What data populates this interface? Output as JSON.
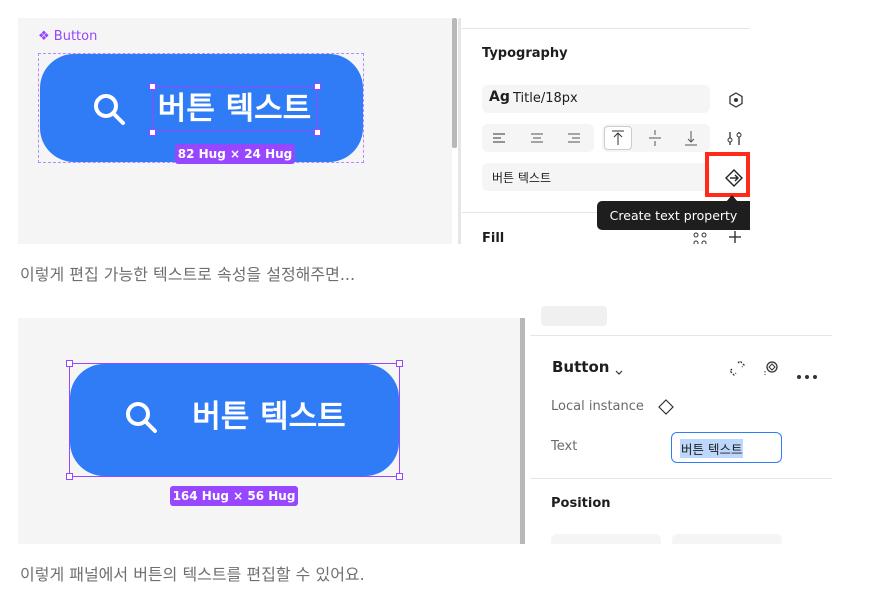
{
  "top": {
    "component_label": "❖ Button",
    "button_text": "버튼 텍스트",
    "size_badge": "82 Hug × 24 Hug",
    "panel": {
      "typography_title": "Typography",
      "text_style_prefix": "Ag",
      "text_style_name": "Title/18px",
      "text_value": "버튼 텍스트",
      "tooltip": "Create text property",
      "fill_title": "Fill"
    },
    "caption": "이렇게 편집 가능한 텍스트로 속성을 설정해주면..."
  },
  "bottom": {
    "button_text": "버튼 텍스트",
    "size_badge": "164 Hug × 56 Hug",
    "panel": {
      "component_name": "Button",
      "local_instance": "Local instance",
      "text_label": "Text",
      "text_value": "버튼 텍스트",
      "position_title": "Position"
    },
    "caption": "이렇게 패널에서 버튼의 텍스트를 편집할 수 있어요."
  },
  "colors": {
    "button_blue": "#2f7cf6",
    "selection_purple": "#9747ff",
    "highlight_red": "#ff2a1a",
    "tooltip_bg": "#1e1e1e"
  }
}
